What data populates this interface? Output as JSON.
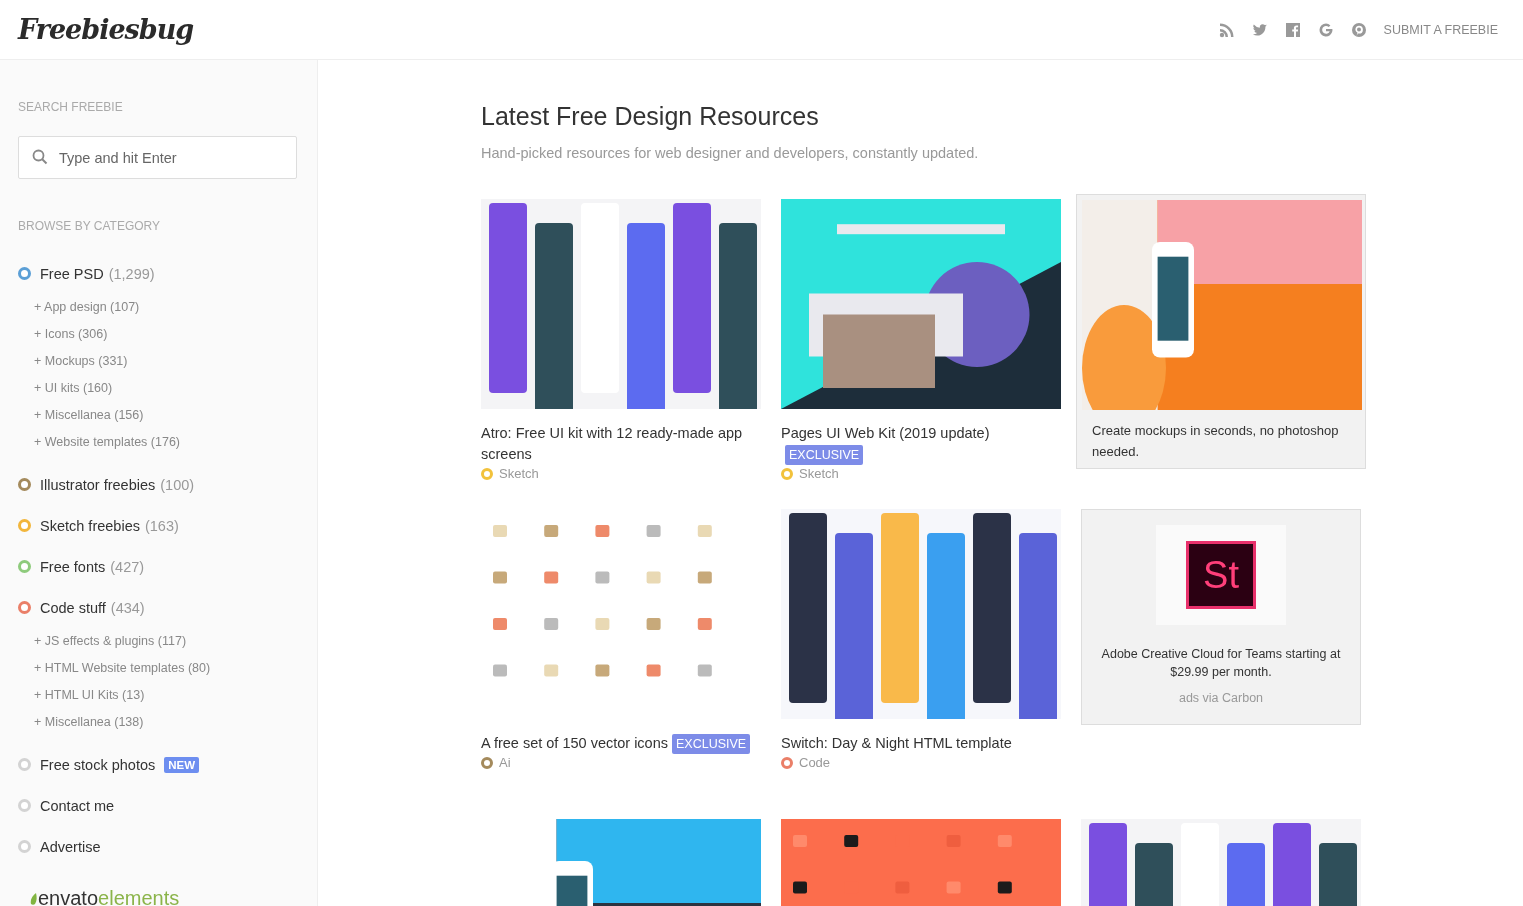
{
  "header": {
    "site_name": "Freebiesbug",
    "social": [
      {
        "kind": "rss"
      },
      {
        "kind": "bird"
      },
      {
        "kind": "f"
      },
      {
        "kind": "g"
      },
      {
        "kind": "p"
      }
    ],
    "submit": "SUBMIT A FREEBIE"
  },
  "sidebar": {
    "search_label": "SEARCH FREEBIE",
    "search": {
      "placeholder": "Type and hit Enter"
    },
    "browse_label": "BROWSE BY CATEGORY",
    "categories": [
      {
        "label": "Free PSD",
        "count": "(1,299)",
        "color": "#5b9fd6",
        "children": [
          "+ App design (107)",
          "+ Icons (306)",
          "+ Mockups (331)",
          "+ UI kits (160)",
          "+ Miscellanea (156)",
          "+ Website templates (176)"
        ]
      },
      {
        "label": "Illustrator freebies",
        "count": "(100)",
        "color": "#a48a5c"
      },
      {
        "label": "Sketch freebies",
        "count": "(163)",
        "color": "#f2b63c"
      },
      {
        "label": "Free fonts",
        "count": "(427)",
        "color": "#8ecb7c"
      },
      {
        "label": "Code stuff",
        "count": "(434)",
        "color": "#ea7f68",
        "children": [
          "+ JS effects & plugins (117)",
          "+ HTML Website templates (80)",
          "+ HTML UI Kits (13)",
          "+ Miscellanea (138)"
        ]
      },
      {
        "label": "Free stock photos",
        "badge": "NEW",
        "color": "#d3d3d3"
      },
      {
        "label": "Contact me",
        "color": "#d3d3d3"
      },
      {
        "label": "Advertise",
        "color": "#d3d3d3"
      }
    ],
    "partner": {
      "first": "envato",
      "second": "elements"
    }
  },
  "main": {
    "title": "Latest Free Design Resources",
    "subtitle": "Hand-picked resources for web designer and developers, constantly updated.",
    "cards": [
      {
        "kind": "post",
        "title": "Atro: Free UI kit with 12 ready-made app screens",
        "tag": "Sketch",
        "color": "#f2c23c"
      },
      {
        "kind": "post",
        "title": "Pages UI Web Kit (2019 update)",
        "badge": "EXCLUSIVE",
        "tag": "Sketch",
        "color": "#f2c23c"
      },
      {
        "kind": "ad",
        "text": "Create mockups in seconds, no photoshop needed."
      },
      {
        "kind": "post",
        "title": "A free set of 150 vector icons",
        "badge": "EXCLUSIVE",
        "tag": "Ai",
        "color": "#a48a5c"
      },
      {
        "kind": "post",
        "title": "Switch: Day & Night HTML template",
        "tag": "Code",
        "color": "#ea7f68"
      },
      {
        "kind": "carbon",
        "logo": "St",
        "text": "Adobe Creative Cloud for Teams starting at $29.99 per month.",
        "via": "ads via Carbon"
      },
      {
        "kind": "partial"
      },
      {
        "kind": "partial"
      },
      {
        "kind": "partial"
      }
    ]
  }
}
